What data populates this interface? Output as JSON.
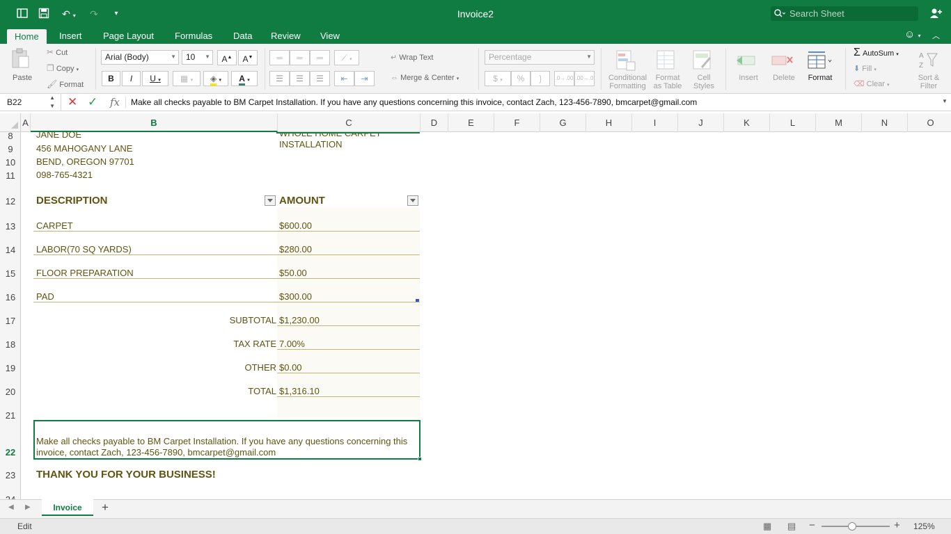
{
  "app": {
    "title": "Invoice2",
    "search_placeholder": "Search Sheet"
  },
  "tabs": [
    "Home",
    "Insert",
    "Page Layout",
    "Formulas",
    "Data",
    "Review",
    "View"
  ],
  "ribbon": {
    "paste": "Paste",
    "cut": "Cut",
    "copy": "Copy",
    "format_painter": "Format",
    "font_name": "Arial (Body)",
    "font_size": "10",
    "bold": "B",
    "italic": "I",
    "underline": "U",
    "wrap_text": "Wrap Text",
    "merge_center": "Merge & Center",
    "number_format": "Percentage",
    "conditional_formatting": [
      "Conditional",
      "Formatting"
    ],
    "format_as_table": [
      "Format",
      "as Table"
    ],
    "cell_styles": [
      "Cell",
      "Styles"
    ],
    "insert": "Insert",
    "delete": "Delete",
    "format": "Format",
    "autosum": "AutoSum",
    "fill": "Fill",
    "clear": "Clear",
    "sort_filter": [
      "Sort &",
      "Filter"
    ]
  },
  "formula_bar": {
    "name_box": "B22",
    "fx": "fx",
    "content": "Make all checks payable to BM Carpet Installation. If you have any questions concerning this invoice, contact Zach, 123-456-7890, bmcarpet@gmail.com"
  },
  "columns": [
    "A",
    "B",
    "C",
    "D",
    "E",
    "F",
    "G",
    "H",
    "I",
    "J",
    "K",
    "L",
    "M",
    "N",
    "O"
  ],
  "selected_column": "B",
  "rows": [
    "8",
    "9",
    "10",
    "11",
    "12",
    "13",
    "14",
    "15",
    "16",
    "17",
    "18",
    "19",
    "20",
    "21",
    "22",
    "23",
    "24"
  ],
  "selected_row": "22",
  "sheet": {
    "bill_to": [
      "JANE DOE",
      "456 MAHOGANY LANE",
      "BEND, OREGON 97701",
      "098-765-4321"
    ],
    "job": [
      "WHOLE HOME CARPET",
      "INSTALLATION"
    ],
    "headers": {
      "description": "DESCRIPTION",
      "amount": "AMOUNT"
    },
    "items": [
      {
        "description": "CARPET",
        "amount": "$600.00"
      },
      {
        "description": "LABOR(70 SQ YARDS)",
        "amount": "$280.00"
      },
      {
        "description": "FLOOR PREPARATION",
        "amount": "$50.00"
      },
      {
        "description": "PAD",
        "amount": "$300.00"
      }
    ],
    "totals": [
      {
        "label": "SUBTOTAL",
        "value": "$1,230.00"
      },
      {
        "label": "TAX RATE",
        "value": "7.00%"
      },
      {
        "label": "OTHER",
        "value": "$0.00"
      },
      {
        "label": "TOTAL",
        "value": "$1,316.10"
      }
    ],
    "note_line1": "Make all checks payable to BM Carpet Installation. If you have any questions concerning this",
    "note_line2": "invoice, contact Zach, 123-456-7890, bmcarpet@gmail.com",
    "thanks": "THANK YOU FOR YOUR BUSINESS!"
  },
  "sheet_tabs": {
    "active": "Invoice",
    "add": "+"
  },
  "status": {
    "mode": "Edit",
    "zoom": "125%",
    "zoom_fraction": 0.45
  },
  "colors": {
    "accent": "#107c41",
    "cell_text": "#5f5410"
  }
}
